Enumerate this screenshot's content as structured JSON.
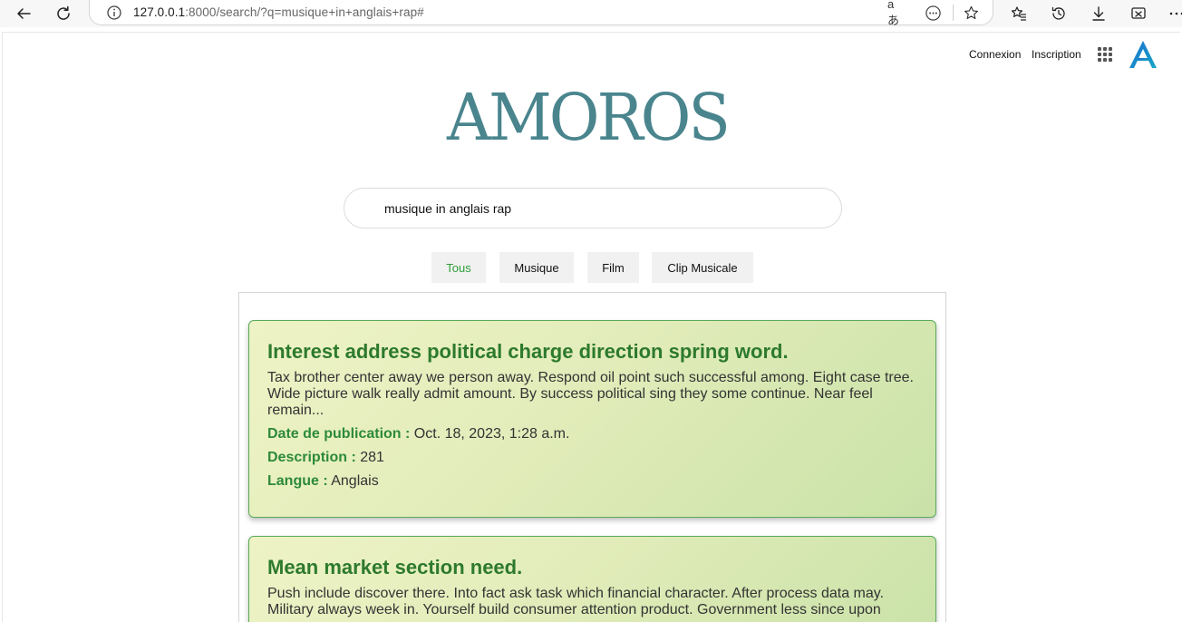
{
  "browser": {
    "url_host": "127.0.0.1",
    "url_rest": ":8000/search/?q=musique+in+anglais+rap#",
    "read_aloud_icon": "aあ"
  },
  "header": {
    "login_label": "Connexion",
    "signup_label": "Inscription"
  },
  "logo": {
    "text": "AMOROS",
    "color": "#4a858e"
  },
  "search": {
    "value": "musique in anglais rap"
  },
  "filters": [
    {
      "label": "Tous",
      "active": true
    },
    {
      "label": "Musique",
      "active": false
    },
    {
      "label": "Film",
      "active": false
    },
    {
      "label": "Clip Musicale",
      "active": false
    }
  ],
  "meta_labels": {
    "date": "Date de publication :",
    "description": "Description :",
    "language": "Langue :"
  },
  "results": [
    {
      "title": "Interest address political charge direction spring word.",
      "excerpt": "Tax brother center away we person away. Respond oil point such successful among. Eight case tree. Wide picture walk really admit amount. By success political sing they some continue. Near feel remain...",
      "date": "Oct. 18, 2023, 1:28 a.m.",
      "description": "281",
      "language": "Anglais"
    },
    {
      "title": "Mean market section need.",
      "excerpt": "Push include discover there. Into fact ask task which financial character. After process data may. Military always week in. Yourself build consumer attention product. Government less since upon"
    }
  ],
  "colors": {
    "accent_green": "#2d7a2d",
    "active_filter": "#2e9e3a"
  }
}
